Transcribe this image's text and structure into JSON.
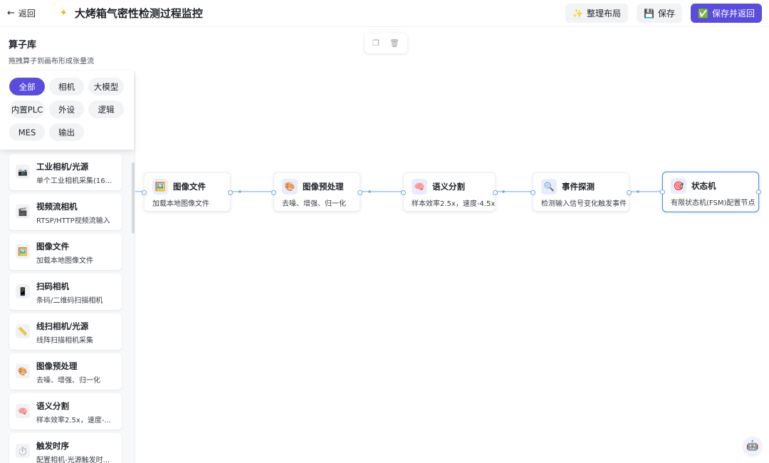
{
  "header": {
    "back_label": "返回",
    "title": "大烤箱气密性检测过程监控",
    "actions": [
      {
        "icon": "✨",
        "label": "整理布局"
      },
      {
        "icon": "💾",
        "label": "保存"
      },
      {
        "icon": "✅",
        "label": "保存并返回"
      }
    ]
  },
  "library": {
    "title": "算子库",
    "subtitle": "拖拽算子到画布形成张量流",
    "chips": [
      "全部",
      "相机",
      "大模型",
      "内置PLC",
      "外设",
      "逻辑",
      "MES",
      "输出"
    ],
    "active_chip": "全部",
    "operators": [
      {
        "icon": "📷",
        "name": "工业相机/光源",
        "desc": "单个工业相机采集(16..."
      },
      {
        "icon": "🎬",
        "name": "视频流相机",
        "desc": "RTSP/HTTP视频流输入"
      },
      {
        "icon": "🖼️",
        "name": "图像文件",
        "desc": "加载本地图像文件"
      },
      {
        "icon": "📱",
        "name": "扫码相机",
        "desc": "条码/二维码扫描相机"
      },
      {
        "icon": "📏",
        "name": "线扫相机/光源",
        "desc": "线阵扫描相机采集"
      },
      {
        "icon": "🎨",
        "name": "图像预处理",
        "desc": "去噪、增强、归一化"
      },
      {
        "icon": "🧠",
        "name": "语义分割",
        "desc": "样本效率2.5x，速度-..."
      },
      {
        "icon": "⏱️",
        "name": "触发时序",
        "desc": "配置相机-光源触发时..."
      }
    ]
  },
  "canvas": {
    "toolbar_icons": [
      "copy-icon",
      "delete-icon"
    ],
    "nodes": [
      {
        "icon": "🖼️",
        "title": "图像文件",
        "desc": "加载本地图像文件"
      },
      {
        "icon": "🎨",
        "title": "图像预处理",
        "desc": "去噪、增强、归一化"
      },
      {
        "icon": "🧠",
        "title": "语义分割",
        "desc": "样本效率2.5x，速度-4.5x"
      },
      {
        "icon": "🔍",
        "title": "事件探测",
        "desc": "检测输入信号变化触发事件"
      },
      {
        "icon": "🎯",
        "title": "状态机",
        "desc": "有限状态机(FSM)配置节点"
      }
    ],
    "selected_node": "状态机"
  },
  "colors": {
    "accent": "#5b4ddb",
    "edge": "#6fa3f2",
    "selected_border": "#4a8ff7"
  }
}
